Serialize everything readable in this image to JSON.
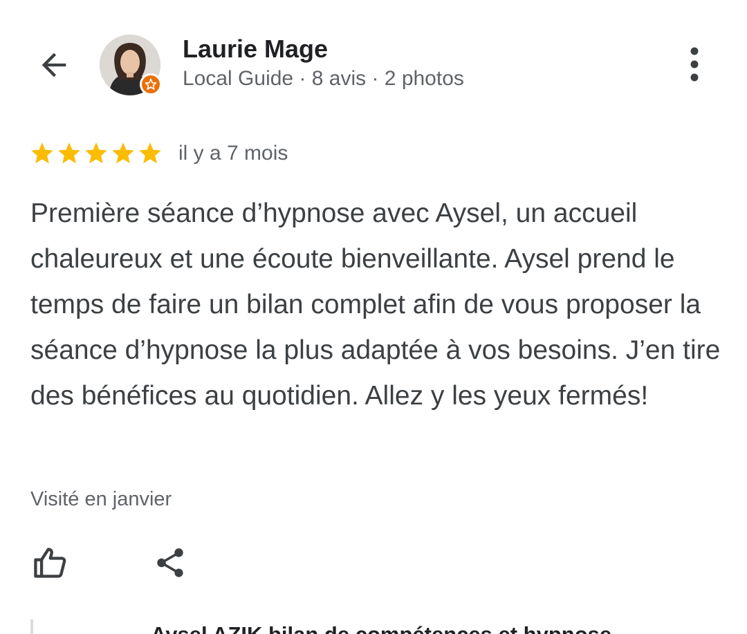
{
  "reviewer": {
    "name": "Laurie Mage",
    "meta": "Local Guide · 8 avis · 2 photos"
  },
  "review": {
    "rating": 5,
    "max_rating": 5,
    "star_color": "#fbbc04",
    "time": "il y a 7 mois",
    "text": "Première séance d’hypnose avec Aysel, un accueil chaleureux et une écoute bienveillante. Aysel prend le temps de faire un bilan complet afin de vous proposer la séance d’hypnose la plus adaptée à vos besoins. J’en tire des bénéfices au quotidien. Allez y les yeux fermés!",
    "visited": "Visité en janvier"
  },
  "owner_response": {
    "owner": "Aysel AZIK bilan de compétences et hypnose"
  },
  "icons": {
    "back": "arrow-back-icon",
    "more": "more-vert-icon",
    "like": "thumb-up-icon",
    "share": "share-icon",
    "badge": "local-guide-star-icon"
  },
  "colors": {
    "badge": "#e8710a",
    "text_primary": "#202124",
    "text_secondary": "#5f6368"
  }
}
